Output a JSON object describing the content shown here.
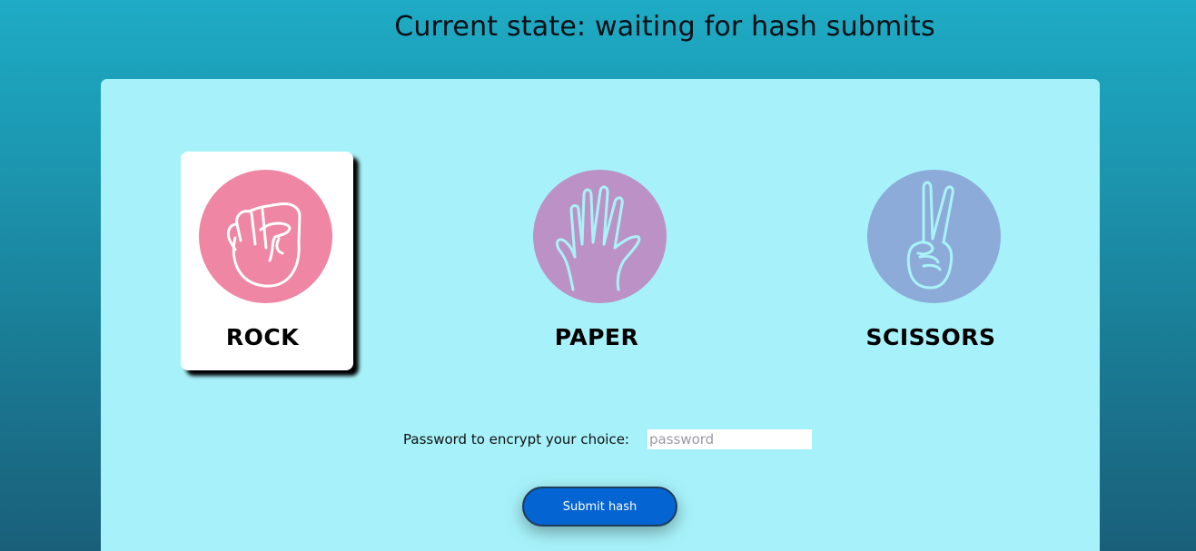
{
  "state": {
    "title": "Current state: waiting for hash submits"
  },
  "choices": [
    {
      "id": "rock",
      "label": "ROCK",
      "icon": "fist-icon",
      "circle_color": "#ef86a3",
      "selected": true
    },
    {
      "id": "paper",
      "label": "PAPER",
      "icon": "open-hand-icon",
      "circle_color": "#bc92c6",
      "selected": false
    },
    {
      "id": "scissors",
      "label": "SCISSORS",
      "icon": "peace-sign-icon",
      "circle_color": "#8dabd9",
      "selected": false
    }
  ],
  "password": {
    "label": "Password to encrypt your choice:",
    "placeholder": "password",
    "value": ""
  },
  "submit": {
    "label": "Submit hash"
  },
  "colors": {
    "panel": "#a7f2fa",
    "button": "#0464d2"
  }
}
